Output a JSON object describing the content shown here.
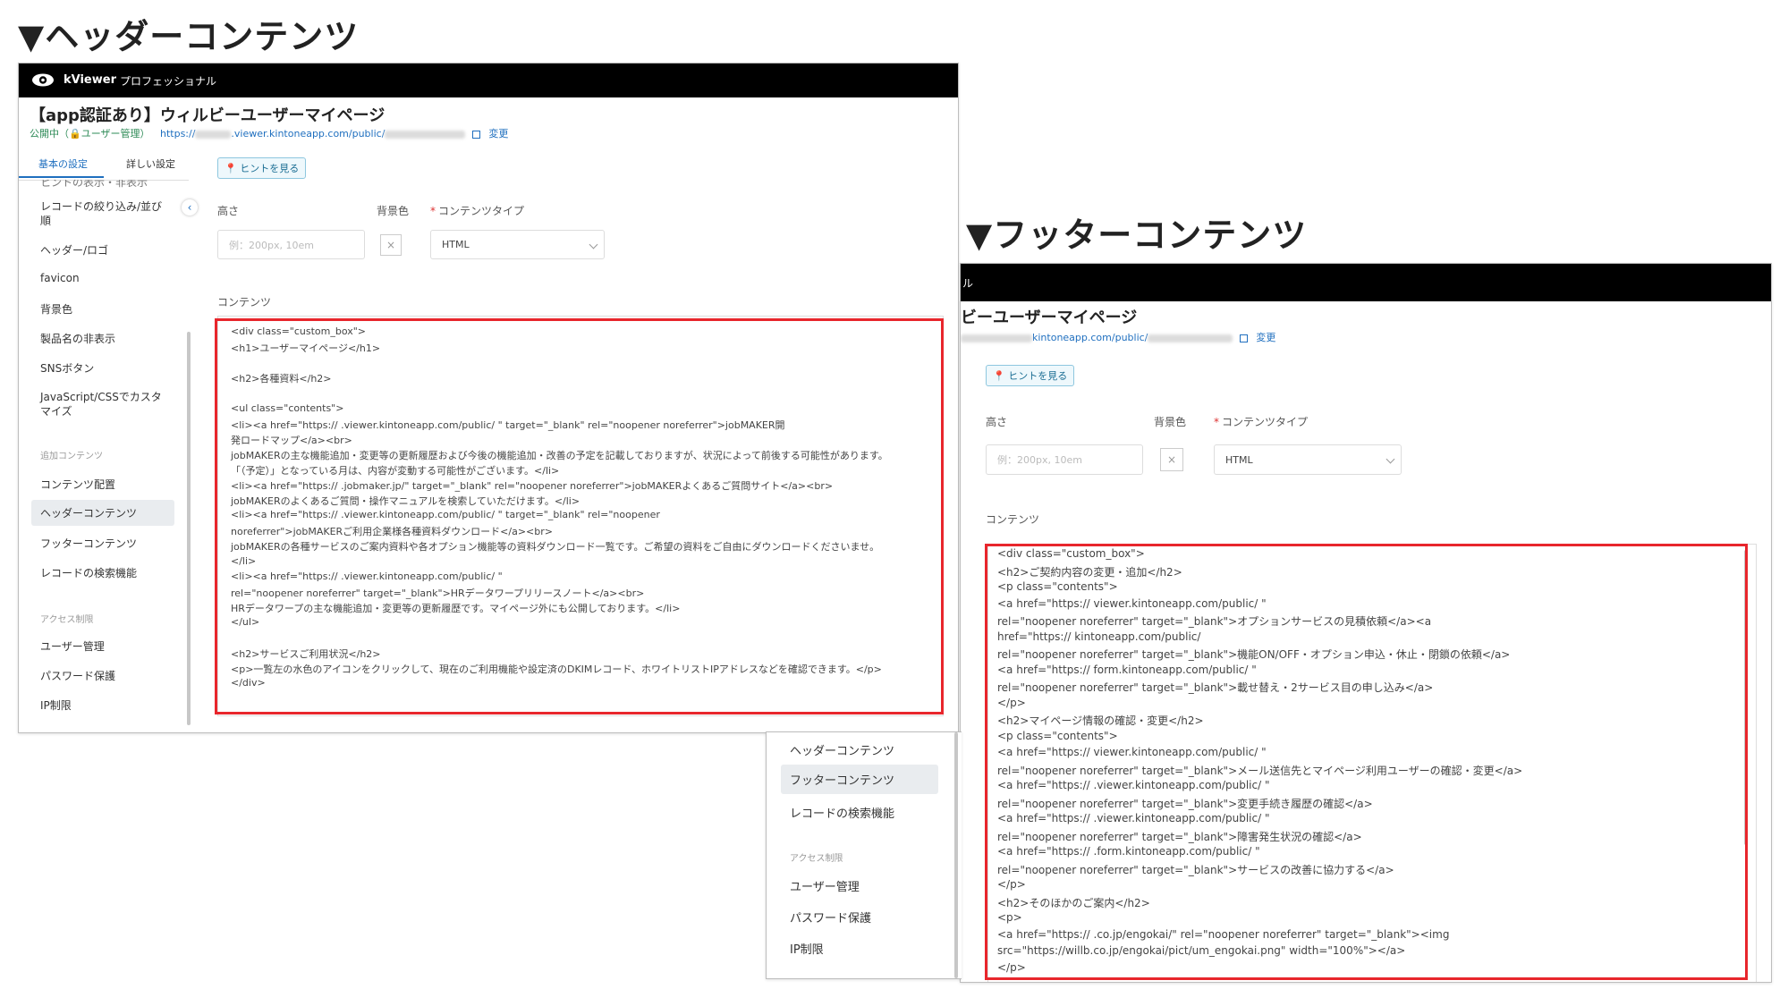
{
  "header_section": {
    "heading": "▼ヘッダーコンテンツ",
    "app_name": "kViewer",
    "edition": "プロフェッショナル",
    "page_title": "【app認証あり】ウィルビーユーザーマイページ",
    "status": "公開中（🔒ユーザー管理）",
    "url_prefix": "https://",
    "url_domain": ".viewer.kintoneapp.com/public/",
    "change_link": "変更",
    "tabs": [
      "基本の設定",
      "詳しい設定"
    ],
    "sidebar_cut_text": "ヒントの表示・非表示",
    "sidebar_items": [
      "レコードの絞り込み/並び順",
      "ヘッダー/ロゴ",
      "favicon",
      "背景色",
      "製品名の非表示",
      "SNSボタン",
      "JavaScript/CSSでカスタマイズ"
    ],
    "sidebar_group1": "追加コンテンツ",
    "sidebar_group1_items": [
      "コンテンツ配置",
      "ヘッダーコンテンツ",
      "フッターコンテンツ",
      "レコードの検索機能"
    ],
    "sidebar_group2": "アクセス制限",
    "sidebar_group2_items": [
      "ユーザー管理",
      "パスワード保護",
      "IP制限"
    ],
    "hint_button": "ヒントを見る",
    "label_height": "高さ",
    "label_bg": "背景色",
    "label_content_type": "コンテンツタイプ",
    "height_placeholder": "例：200px, 10em",
    "color_clear": "×",
    "content_type_value": "HTML",
    "label_content": "コンテンツ",
    "code": [
      "<div class=\"custom_box\">",
      "<h1>ユーザーマイページ</h1>",
      "",
      "<h2>各種資料</h2>",
      "",
      "<ul class=\"contents\">",
      "<li><a href=\"https://        .viewer.kintoneapp.com/public/                                  \" target=\"_blank\" rel=\"noopener noreferrer\">jobMAKER開",
      "発ロードマップ</a><br>",
      "jobMAKERの主な機能追加・変更等の更新履歴および今後の機能追加・改善の予定を記載しておりますが、状況によって前後する可能性があります。",
      "「（予定）」となっている月は、内容が変動する可能性がございます。</li>",
      "<li><a href=\"https://        .jobmaker.jp/\" target=\"_blank\" rel=\"noopener noreferrer\">jobMAKERよくあるご質問サイト</a><br>",
      "jobMAKERのよくあるご質問・操作マニュアルを検索していただけます。</li>",
      "<li><a href=\"https://        .viewer.kintoneapp.com/public/                                  \" target=\"_blank\" rel=\"noopener",
      "noreferrer\">jobMAKERご利用企業様各種資料ダウンロード</a><br>",
      "jobMAKERの各種サービスのご案内資料や各オプション機能等の資料ダウンロード一覧です。ご希望の資料をご自由にダウンロードくださいませ。",
      "</li>",
      "<li><a href=\"https://        .viewer.kintoneapp.com/public/                                                                    \"",
      "rel=\"noopener noreferrer\" target=\"_blank\">HRデータワープリリースノート</a><br>",
      "HRデータワープの主な機能追加・変更等の更新履歴です。マイページ外にも公開しております。</li>",
      "</ul>",
      "",
      "<h2>サービスご利用状況</h2>",
      "<p>一覧左の水色のアイコンをクリックして、現在のご利用機能や設定済のDKIMレコード、ホワイトリストIPアドレスなどを確認できます。</p>",
      "</div>"
    ]
  },
  "footer_section": {
    "heading": "▼フッターコンテンツ",
    "bar_clip": "ル",
    "page_title": "ビーユーザーマイページ",
    "url_domain": "kintoneapp.com/public/",
    "change_link": "変更",
    "hint_button": "ヒントを見る",
    "label_height": "高さ",
    "label_bg": "背景色",
    "label_content_type": "コンテンツタイプ",
    "height_placeholder": "例：200px, 10em",
    "color_clear": "×",
    "content_type_value": "HTML",
    "label_content": "コンテンツ",
    "sidebar_items": [
      "ヘッダーコンテンツ",
      "フッターコンテンツ",
      "レコードの検索機能"
    ],
    "sidebar_group": "アクセス制限",
    "sidebar_group_items": [
      "ユーザー管理",
      "パスワード保護",
      "IP制限"
    ],
    "code": [
      "<div class=\"custom_box\">",
      "<h2>ご契約内容の変更・追加</h2>",
      "<p class=\"contents\">",
      "<a href=\"https://          viewer.kintoneapp.com/public/                                                    \"",
      "rel=\"noopener noreferrer\" target=\"_blank\">オプションサービスの見積依頼</a><a",
      "href=\"https://              kintoneapp.com/public/",
      "rel=\"noopener noreferrer\" target=\"_blank\">機能ON/OFF・オプション申込・休止・閉鎖の依頼</a>",
      "<a href=\"https://         form.kintoneapp.com/public/                                                      \"",
      "rel=\"noopener noreferrer\" target=\"_blank\">載せ替え・2サービス目の申し込み</a>",
      "</p>",
      "<h2>マイページ情報の確認・変更</h2>",
      "<p class=\"contents\">",
      "<a href=\"https://          viewer.kintoneapp.com/public/                                                    \"",
      "rel=\"noopener noreferrer\" target=\"_blank\">メール送信先とマイページ利用ユーザーの確認・変更</a>",
      "<a href=\"https://         .viewer.kintoneapp.com/public/                                                      \"",
      "rel=\"noopener noreferrer\" target=\"_blank\">変更手続き履歴の確認</a>",
      "<a href=\"https://         .viewer.kintoneapp.com/public/                                                          \"",
      "rel=\"noopener noreferrer\" target=\"_blank\">障害発生状況の確認</a>",
      "<a href=\"https://         .form.kintoneapp.com/public/                                                    \"",
      "rel=\"noopener noreferrer\" target=\"_blank\">サービスの改善に協力する</a>",
      "</p>",
      "<h2>そのほかのご案内</h2>",
      "<p>",
      "<a href=\"https://          .co.jp/engokai/\" rel=\"noopener noreferrer\" target=\"_blank\"><img",
      "src=\"https://willb.co.jp/engokai/pict/um_engokai.png\" width=\"100%\"></a>",
      "</p>"
    ]
  }
}
